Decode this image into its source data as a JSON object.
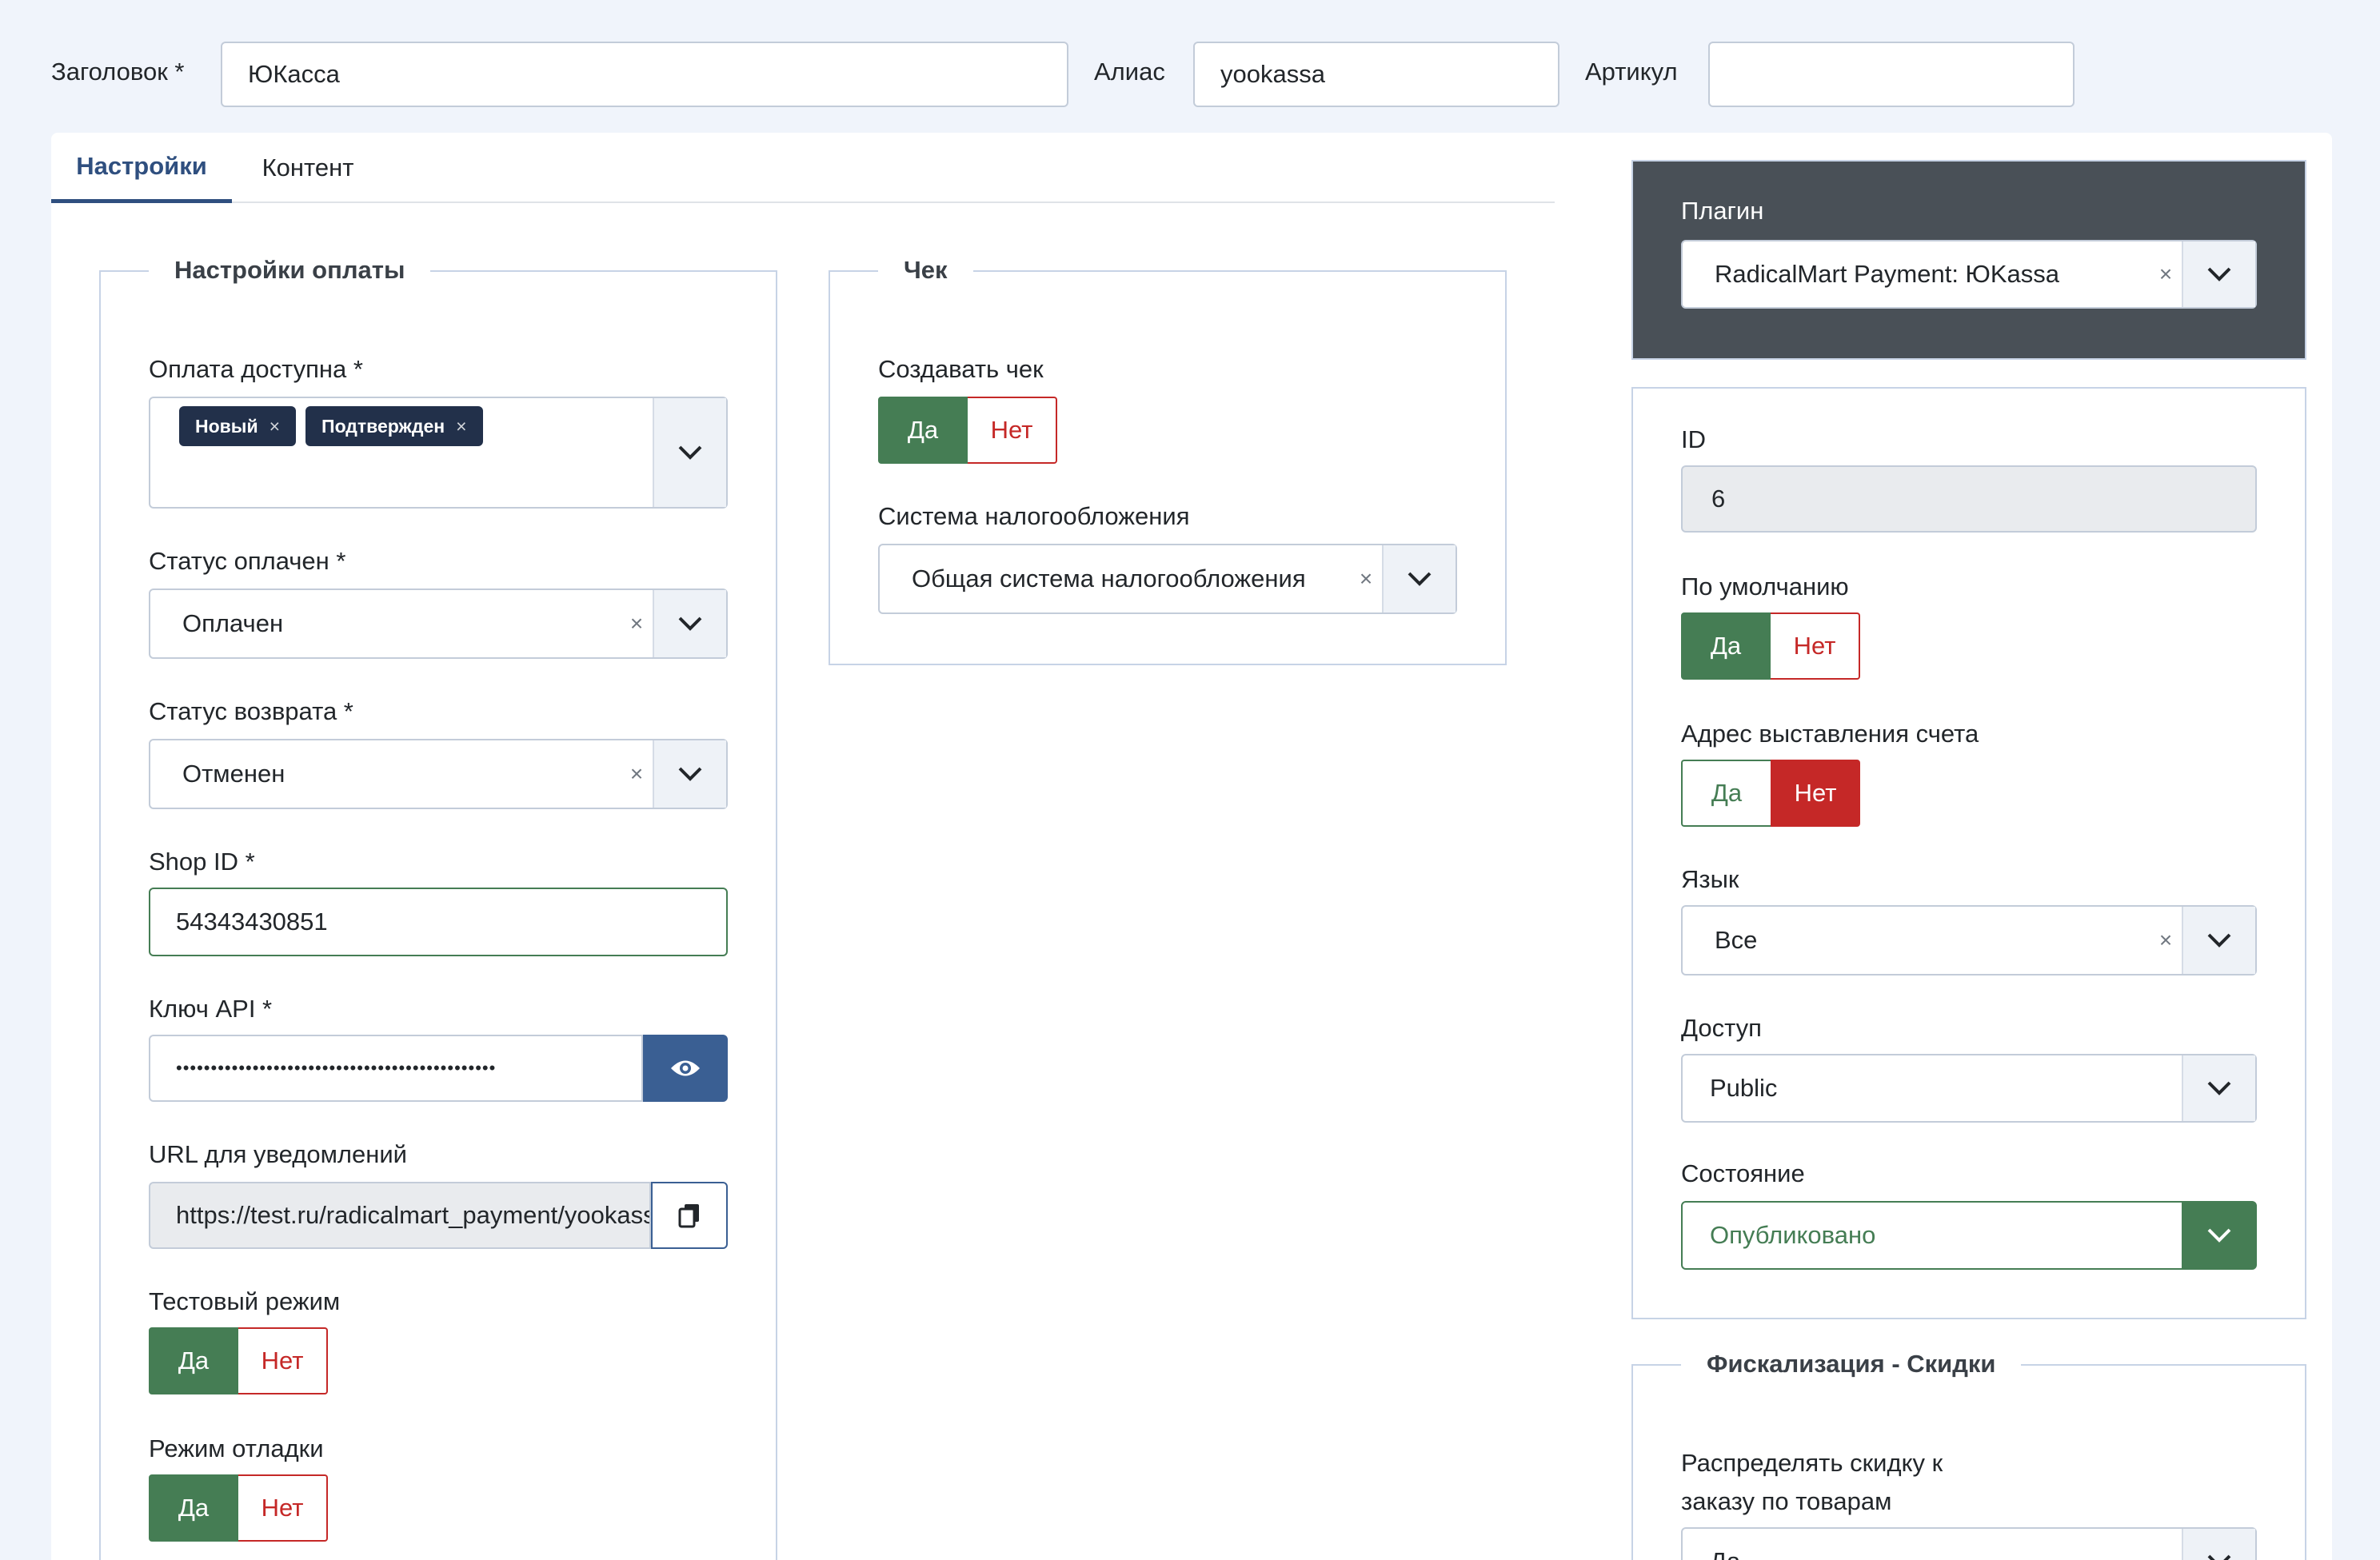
{
  "header": {
    "title_label": "Заголовок *",
    "title_value": "ЮКасса",
    "alias_label": "Алиас",
    "alias_value": "yookassa",
    "sku_label": "Артикул",
    "sku_value": ""
  },
  "tabs": [
    {
      "label": "Настройки",
      "active": true
    },
    {
      "label": "Контент",
      "active": false
    }
  ],
  "payment": {
    "legend": "Настройки оплаты",
    "available_label": "Оплата доступна *",
    "available_tags": [
      "Новый",
      "Подтвержден"
    ],
    "paid_label": "Статус оплачен *",
    "paid_value": "Оплачен",
    "refund_label": "Статус возврата *",
    "refund_value": "Отменен",
    "shop_id_label": "Shop ID *",
    "shop_id_value": "54343430851",
    "api_key_label": "Ключ API *",
    "api_key_value": "••••••••••••••••••••••••••••••••••••••••••••••",
    "url_label": "URL для уведомлений",
    "url_value": "https://test.ru/radicalmart_payment/yookassa",
    "test_label": "Тестовый режим",
    "debug_label": "Режим отладки"
  },
  "receipt": {
    "legend": "Чек",
    "create_label": "Создавать чек",
    "tax_label": "Система налогообложения",
    "tax_value": "Общая система налогообложения"
  },
  "toggle": {
    "yes": "Да",
    "no": "Нет"
  },
  "sidebar": {
    "plugin_label": "Плагин",
    "plugin_value": "RadicalMart Payment: ЮKassa",
    "id_label": "ID",
    "id_value": "6",
    "default_label": "По умолчанию",
    "billing_label": "Адрес выставления счета",
    "language_label": "Язык",
    "language_value": "Все",
    "access_label": "Доступ",
    "access_value": "Public",
    "state_label": "Состояние",
    "state_value": "Опубликовано",
    "fiscal_legend": "Фискализация - Скидки",
    "discount_label_1": "Распределять скидку к",
    "discount_label_2": "заказу по товарам",
    "discount_value": "Да"
  },
  "colors": {
    "accent": "#2f4f7f",
    "success": "#457d54",
    "danger": "#c52827",
    "dark_panel": "#495057"
  }
}
